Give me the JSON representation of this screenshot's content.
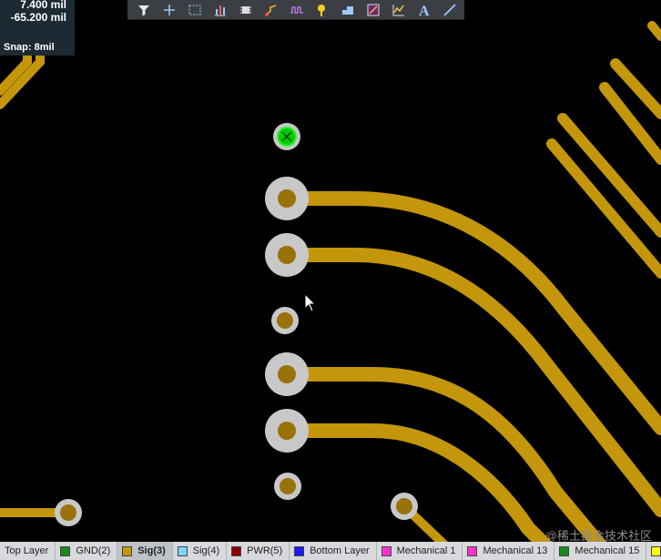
{
  "coordinates": {
    "x": "7.400  mil",
    "y": "-65.200  mil",
    "snap": "Snap: 8mil"
  },
  "toolbar": {
    "tools": [
      {
        "name": "filter-icon"
      },
      {
        "name": "crosshair-icon"
      },
      {
        "name": "select-rect-icon"
      },
      {
        "name": "chart-icon"
      },
      {
        "name": "component-icon"
      },
      {
        "name": "route-icon"
      },
      {
        "name": "tune-length-icon"
      },
      {
        "name": "via-icon"
      },
      {
        "name": "polygon-icon"
      },
      {
        "name": "board-icon"
      },
      {
        "name": "graph-icon"
      },
      {
        "name": "text-icon"
      },
      {
        "name": "line-icon"
      }
    ]
  },
  "layer_tabs": [
    {
      "label": "Top Layer",
      "color": ""
    },
    {
      "label": "GND(2)",
      "color": "#1a8a1a"
    },
    {
      "label": "Sig(3)",
      "color": "#c4960c",
      "active": true
    },
    {
      "label": "Sig(4)",
      "color": "#7fd4ff"
    },
    {
      "label": "PWR(5)",
      "color": "#8b0000"
    },
    {
      "label": "Bottom Layer",
      "color": "#1a1aff"
    },
    {
      "label": "Mechanical 1",
      "color": "#ff33cc"
    },
    {
      "label": "Mechanical 13",
      "color": "#ff33cc"
    },
    {
      "label": "Mechanical 15",
      "color": "#1a8a1a"
    },
    {
      "label": "",
      "color": "#ffff00"
    }
  ],
  "colors": {
    "trace": "#c4960c",
    "pad_ring": "#c8c8c8",
    "pad_hole": "#9a720c",
    "selected": "#00cc00"
  },
  "watermark": "@稀土掘金技术社区"
}
